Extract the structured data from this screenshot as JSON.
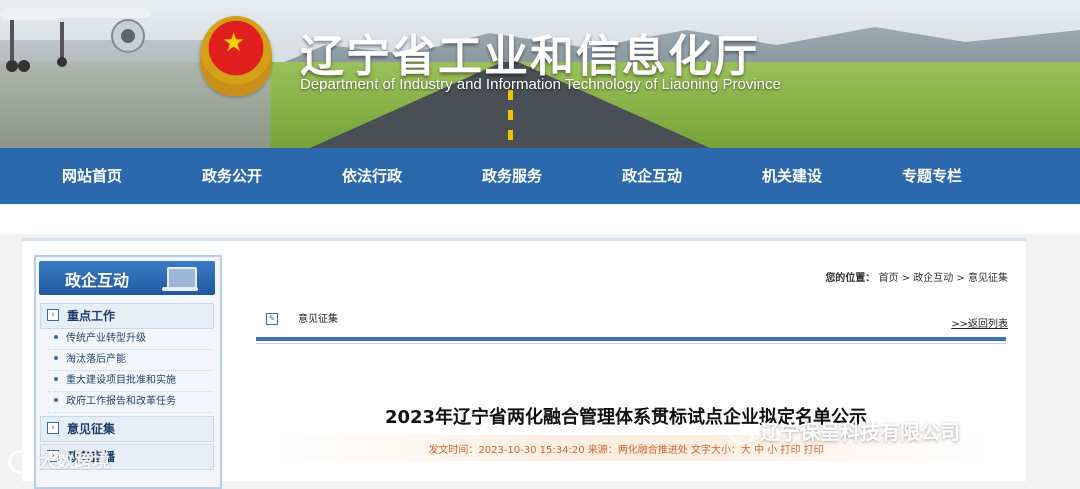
{
  "header": {
    "title": "辽宁省工业和信息化厅",
    "subtitle": "Department of Industry and Information Technology of Liaoning Province"
  },
  "nav": {
    "items": [
      "网站首页",
      "政务公开",
      "依法行政",
      "政务服务",
      "政企互动",
      "机关建设",
      "专题专栏"
    ]
  },
  "sidebar": {
    "title": "政企互动",
    "categories": [
      {
        "label": "重点工作",
        "items": [
          "传统产业转型升级",
          "淘汰落后产能",
          "重大建设项目批准和实施",
          "政府工作报告和改革任务"
        ]
      },
      {
        "label": "意见征集",
        "items": []
      },
      {
        "label": "政务直播",
        "items": []
      }
    ]
  },
  "main": {
    "breadcrumb": {
      "label": "您的位置：",
      "path": [
        "首页",
        "政企互动",
        "意见征集"
      ],
      "separator": " > "
    },
    "section_label": "意见征集",
    "back_link": ">>返回列表",
    "article": {
      "title": "2023年辽宁省两化融合管理体系贯标试点企业拟定名单公示",
      "meta": "发文时间：2023-10-30 15:34:20 来源：两化融合推进处 文字大小：大 中 小   打印   打印"
    }
  },
  "watermarks": {
    "left": "大数跨境",
    "right": "辽宁保呈科技有限公司"
  },
  "colors": {
    "nav_bg": "#2c68ac",
    "sidebar_head": "#21589d",
    "meta_text": "#d4622a"
  }
}
